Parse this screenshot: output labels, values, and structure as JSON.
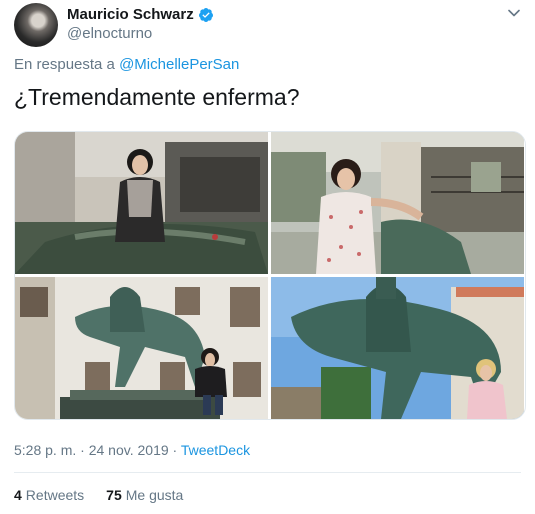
{
  "author": {
    "display_name": "Mauricio Schwarz",
    "handle": "@elnocturno",
    "verified": true
  },
  "tweet": {
    "reply_prefix": "En respuesta a",
    "reply_mention": "@MichellePerSan",
    "text": "¿Tremendamente enferma?"
  },
  "media": {
    "photos": [
      {
        "icon": "photo-tomb-woman-dark-hair"
      },
      {
        "icon": "photo-tomb-woman-floral-dress"
      },
      {
        "icon": "photo-equestrian-statue-woman"
      },
      {
        "icon": "photo-equestrian-statue-blonde-woman"
      }
    ]
  },
  "meta": {
    "time": "5:28 p. m.",
    "separator1": "·",
    "date": "24 nov. 2019",
    "separator2": "·",
    "source": "TweetDeck"
  },
  "stats": {
    "retweets_count": "4",
    "retweets_label": "Retweets",
    "likes_count": "75",
    "likes_label": "Me gusta"
  },
  "colors": {
    "link": "#1b95e0",
    "secondary_text": "#657786",
    "verified_badge": "#1da1f2"
  }
}
